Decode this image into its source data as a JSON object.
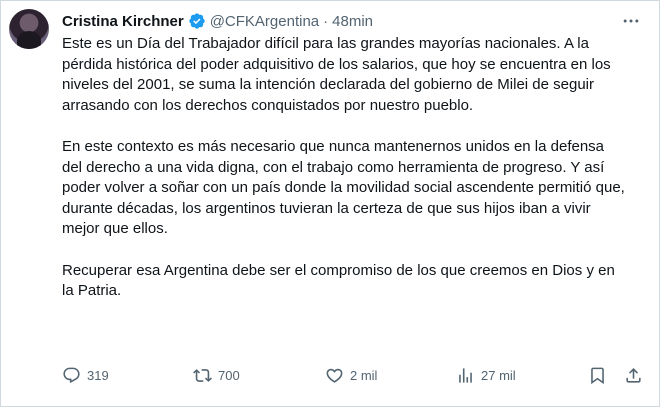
{
  "author": {
    "name": "Cristina Kirchner",
    "handle": "@CFKArgentina",
    "separator": "·",
    "time": "48min"
  },
  "tweet": {
    "paragraphs": [
      "Este es un Día del Trabajador difícil para las grandes mayorías nacionales. A la pérdida histórica del poder adquisitivo de los salarios, que hoy se encuentra en los niveles del 2001, se suma la intención declarada del gobierno de Milei de seguir arrasando con los derechos conquistados por nuestro pueblo.",
      "En este contexto es más necesario que nunca mantenernos unidos en la defensa del derecho a una vida digna, con el trabajo como herramienta de progreso. Y así poder volver a soñar con un país donde la movilidad social ascendente permitió que, durante décadas, los argentinos tuvieran la certeza de que sus hijos iban a vivir mejor que ellos.",
      "Recuperar esa Argentina debe ser el compromiso de los que creemos en Dios y en la Patria."
    ]
  },
  "metrics": {
    "replies": "319",
    "retweets": "700",
    "likes": "2 mil",
    "views": "27 mil"
  },
  "colors": {
    "text": "#0f1419",
    "muted": "#536471",
    "verified": "#1d9bf0",
    "border": "#cfd9de"
  },
  "icons": [
    "verified-badge-icon",
    "more-icon",
    "reply-icon",
    "retweet-icon",
    "like-icon",
    "views-icon",
    "bookmark-icon",
    "share-icon"
  ]
}
